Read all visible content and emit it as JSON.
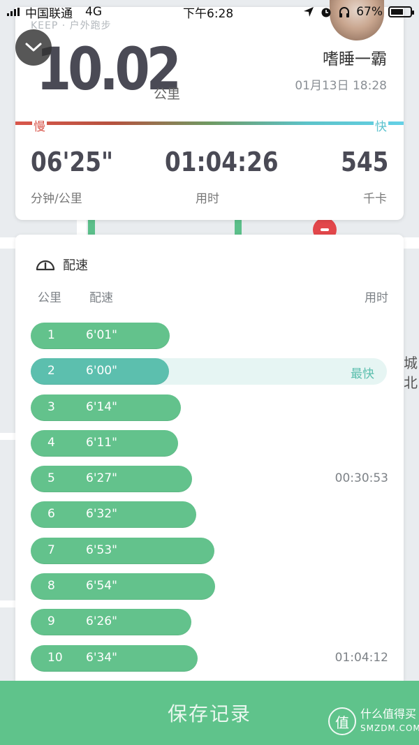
{
  "status_bar": {
    "carrier": "中国联通",
    "network": "4G",
    "time": "下午6:28",
    "battery": "67%",
    "battery_level": 0.67
  },
  "summary": {
    "brand": "KEEP · 户外跑步",
    "distance": "10.02",
    "distance_unit": "公里",
    "username": "嗜睡一霸",
    "datetime": "01月13日 18:28",
    "slow_label": "慢",
    "fast_label": "快",
    "stats": {
      "avg_pace": {
        "value": "06'25\"",
        "label": "分钟/公里"
      },
      "duration": {
        "value": "01:04:26",
        "label": "用时"
      },
      "calories": {
        "value": "545",
        "label": "千卡"
      }
    }
  },
  "map": {
    "poi_text": "城北"
  },
  "pace_section": {
    "title": "配速",
    "headers": {
      "km": "公里",
      "pace": "配速",
      "time": "用时"
    },
    "best_label": "最快",
    "splits": [
      {
        "km": "1",
        "pace": "6'01\"",
        "time": "",
        "seconds": 361,
        "best": false
      },
      {
        "km": "2",
        "pace": "6'00\"",
        "time": "",
        "seconds": 360,
        "best": true
      },
      {
        "km": "3",
        "pace": "6'14\"",
        "time": "",
        "seconds": 374,
        "best": false
      },
      {
        "km": "4",
        "pace": "6'11\"",
        "time": "",
        "seconds": 371,
        "best": false
      },
      {
        "km": "5",
        "pace": "6'27\"",
        "time": "00:30:53",
        "seconds": 387,
        "best": false
      },
      {
        "km": "6",
        "pace": "6'32\"",
        "time": "",
        "seconds": 392,
        "best": false
      },
      {
        "km": "7",
        "pace": "6'53\"",
        "time": "",
        "seconds": 413,
        "best": false
      },
      {
        "km": "8",
        "pace": "6'54\"",
        "time": "",
        "seconds": 414,
        "best": false
      },
      {
        "km": "9",
        "pace": "6'26\"",
        "time": "",
        "seconds": 386,
        "best": false
      },
      {
        "km": "10",
        "pace": "6'34\"",
        "time": "01:04:12",
        "seconds": 394,
        "best": false
      }
    ]
  },
  "save_button": {
    "label": "保存记录"
  },
  "watermark": {
    "cn": "什么值得买",
    "en": "SMZDM.COM",
    "logo_char": "值"
  },
  "colors": {
    "accent_green": "#5fc38b",
    "best_teal": "#5cbfae",
    "slow_red": "#d9564b",
    "fast_cyan": "#5cc3cf"
  }
}
